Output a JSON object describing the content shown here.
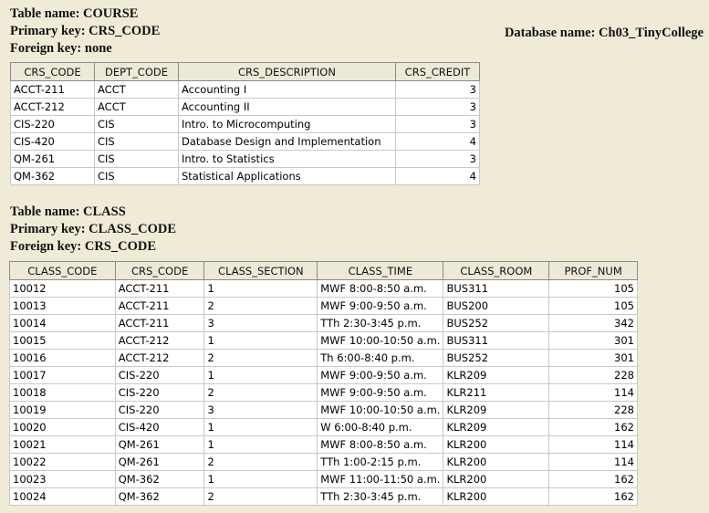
{
  "database_label": "Database name: Ch03_TinyCollege",
  "course": {
    "table_name": "Table name: COURSE",
    "primary_key": "Primary key: CRS_CODE",
    "foreign_key": "Foreign key: none",
    "columns": [
      "CRS_CODE",
      "DEPT_CODE",
      "CRS_DESCRIPTION",
      "CRS_CREDIT"
    ],
    "rows": [
      [
        "ACCT-211",
        "ACCT",
        "Accounting I",
        "3"
      ],
      [
        "ACCT-212",
        "ACCT",
        "Accounting II",
        "3"
      ],
      [
        "CIS-220",
        "CIS",
        "Intro. to Microcomputing",
        "3"
      ],
      [
        "CIS-420",
        "CIS",
        "Database Design and Implementation",
        "4"
      ],
      [
        "QM-261",
        "CIS",
        "Intro. to Statistics",
        "3"
      ],
      [
        "QM-362",
        "CIS",
        "Statistical Applications",
        "4"
      ]
    ]
  },
  "class": {
    "table_name": "Table name: CLASS",
    "primary_key": "Primary key: CLASS_CODE",
    "foreign_key": "Foreign key: CRS_CODE",
    "columns": [
      "CLASS_CODE",
      "CRS_CODE",
      "CLASS_SECTION",
      "CLASS_TIME",
      "CLASS_ROOM",
      "PROF_NUM"
    ],
    "rows": [
      [
        "10012",
        "ACCT-211",
        "1",
        "MWF 8:00-8:50 a.m.",
        "BUS311",
        "105"
      ],
      [
        "10013",
        "ACCT-211",
        "2",
        "MWF 9:00-9:50 a.m.",
        "BUS200",
        "105"
      ],
      [
        "10014",
        "ACCT-211",
        "3",
        "TTh 2:30-3:45 p.m.",
        "BUS252",
        "342"
      ],
      [
        "10015",
        "ACCT-212",
        "1",
        "MWF 10:00-10:50 a.m.",
        "BUS311",
        "301"
      ],
      [
        "10016",
        "ACCT-212",
        "2",
        "Th 6:00-8:40 p.m.",
        "BUS252",
        "301"
      ],
      [
        "10017",
        "CIS-220",
        "1",
        "MWF 9:00-9:50 a.m.",
        "KLR209",
        "228"
      ],
      [
        "10018",
        "CIS-220",
        "2",
        "MWF 9:00-9:50 a.m.",
        "KLR211",
        "114"
      ],
      [
        "10019",
        "CIS-220",
        "3",
        "MWF 10:00-10:50 a.m.",
        "KLR209",
        "228"
      ],
      [
        "10020",
        "CIS-420",
        "1",
        "W 6:00-8:40 p.m.",
        "KLR209",
        "162"
      ],
      [
        "10021",
        "QM-261",
        "1",
        "MWF 8:00-8:50 a.m.",
        "KLR200",
        "114"
      ],
      [
        "10022",
        "QM-261",
        "2",
        "TTh 1:00-2:15 p.m.",
        "KLR200",
        "114"
      ],
      [
        "10023",
        "QM-362",
        "1",
        "MWF 11:00-11:50 a.m.",
        "KLR200",
        "162"
      ],
      [
        "10024",
        "QM-362",
        "2",
        "TTh 2:30-3:45 p.m.",
        "KLR200",
        "162"
      ]
    ]
  }
}
